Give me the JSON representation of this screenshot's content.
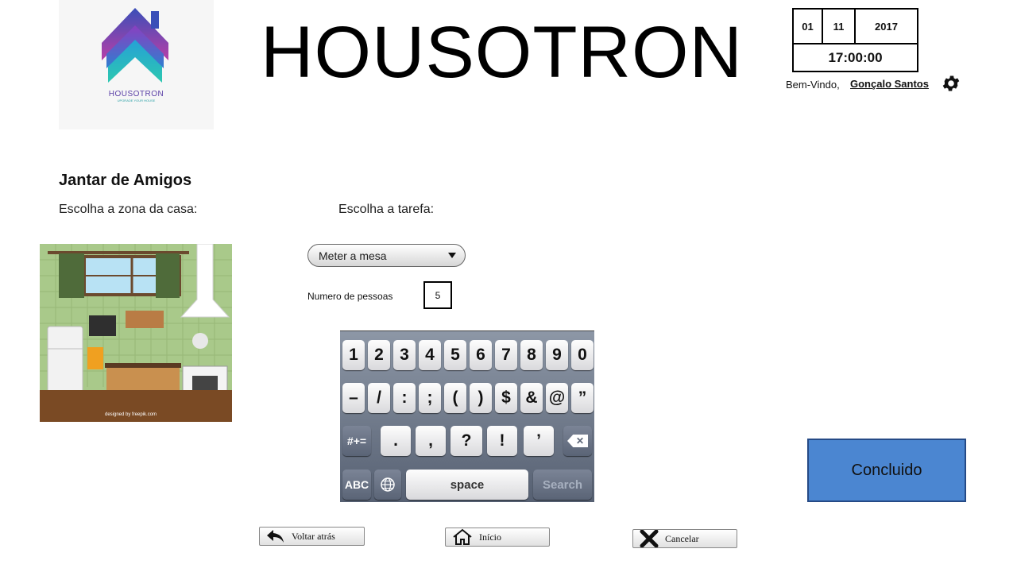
{
  "app": {
    "title": "HOUSOTRON",
    "logo": {
      "name": "HOUSOTRON",
      "tagline": "UPGRADE YOUR HOUSE"
    }
  },
  "header": {
    "date": {
      "day": "01",
      "month": "11",
      "year": "2017"
    },
    "time": "17:00:00",
    "welcome_label": "Bem-Vindo,",
    "user_name": "Gonçalo Santos",
    "settings_icon": "gear-icon"
  },
  "main": {
    "section_title": "Jantar de Amigos",
    "zone_label": "Escolha a zona da casa:",
    "task_label": "Escolha a tarefa:",
    "task_select": {
      "value": "Meter a mesa"
    },
    "people": {
      "label": "Numero de pessoas",
      "value": "5"
    },
    "kitchen_image": {
      "credit": "designed by freepik.com"
    }
  },
  "keyboard": {
    "row1": [
      "1",
      "2",
      "3",
      "4",
      "5",
      "6",
      "7",
      "8",
      "9",
      "0"
    ],
    "row2": [
      "–",
      "/",
      ":",
      ";",
      "(",
      ")",
      "$",
      "&",
      "@",
      "”"
    ],
    "row3": [
      ".",
      ",",
      "?",
      "!",
      "’"
    ],
    "shift_label": "#+=",
    "abc_label": "ABC",
    "space_label": "space",
    "search_label": "Search"
  },
  "actions": {
    "done_label": "Concluido",
    "back_label": "Voltar atrás",
    "home_label": "Início",
    "cancel_label": "Cancelar"
  },
  "colors": {
    "done_button": "#4b86d1",
    "done_border": "#254a86"
  }
}
